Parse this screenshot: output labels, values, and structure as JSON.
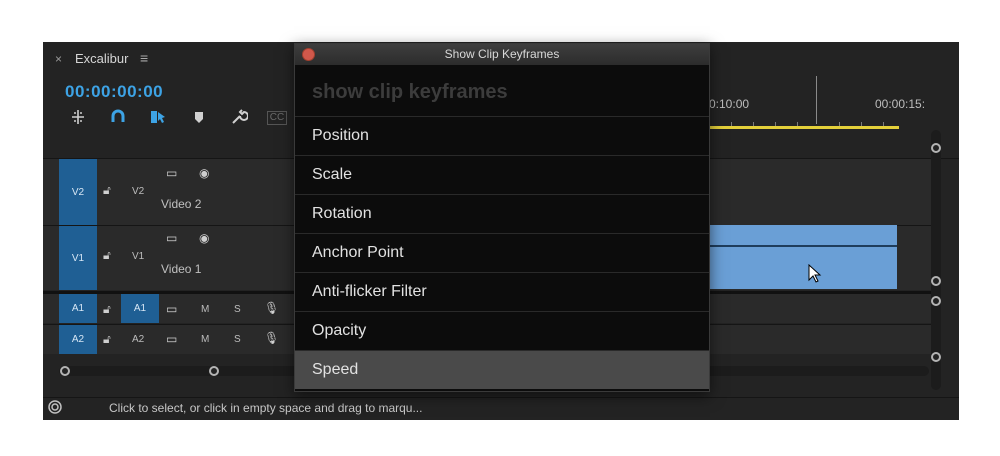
{
  "panel": {
    "tab": {
      "close_glyph": "×",
      "title": "Excalibur",
      "menu_glyph": "≡"
    },
    "timecode": "00:00:00:00",
    "tools": [
      "snap-icon",
      "magnet-icon",
      "linked-selection-icon",
      "marker-icon",
      "wrench-icon",
      "captions-icon"
    ],
    "captions_label": "CC",
    "ruler": {
      "times": [
        "0:10:00",
        "00:00:15:"
      ]
    },
    "tracks": {
      "video": [
        {
          "source": "V2",
          "target": "V2",
          "name": "Video 2"
        },
        {
          "source": "V1",
          "target": "V1",
          "name": "Video 1"
        }
      ],
      "audio": [
        {
          "source": "A1",
          "target": "A1",
          "m": "M",
          "s": "S"
        },
        {
          "source": "A2",
          "target": "A2",
          "m": "M",
          "s": "S"
        }
      ]
    },
    "status_text": "Click to select, or click in empty space and drag to marqu..."
  },
  "popup": {
    "title": "Show Clip Keyframes",
    "search_placeholder": "show clip keyframes",
    "items": [
      "Position",
      "Scale",
      "Rotation",
      "Anchor Point",
      "Anti-flicker Filter",
      "Opacity",
      "Speed"
    ],
    "selected": "Speed"
  },
  "colors": {
    "accent": "#3da3e5",
    "track_target": "#1f5f94",
    "clip": "#6a9fd6",
    "work_area": "#e4d03a",
    "close_button": "#d0584b"
  }
}
